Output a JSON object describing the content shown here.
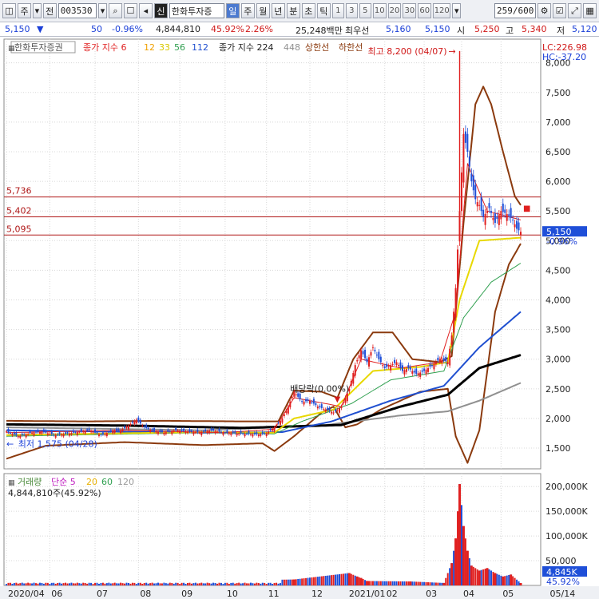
{
  "toolbar": {
    "market": "주",
    "scope": "전",
    "code": "003530",
    "badge": "신",
    "name": "한화투자증",
    "periods": [
      "일",
      "주",
      "월",
      "년",
      "분",
      "초",
      "틱"
    ],
    "selected_period": "일",
    "intervals": [
      "1",
      "3",
      "5",
      "10",
      "20",
      "30",
      "60",
      "120"
    ],
    "count": "259/600"
  },
  "quote": {
    "price": "5,150",
    "change": "50",
    "change_pct": "-0.96%",
    "volume": "4,844,810",
    "turnover": "45.92%",
    "ratio": "2.26%",
    "amount": "25,248백만",
    "best_label": "최우선",
    "bid": "5,160",
    "ask": "5,150",
    "open_label": "시",
    "open": "5,250",
    "high_label": "고",
    "high": "5,340",
    "low_label": "저",
    "low": "5,120"
  },
  "price_legend": {
    "broker": "한화투자증권",
    "ma_label": "종가 지수 6",
    "ma2": "12",
    "ma3": "33",
    "ma4": "56",
    "ma5": "112",
    "env_label": "종가 지수 224",
    "env2": "448",
    "upper": "상한선",
    "lower": "하한선"
  },
  "annotations": {
    "lc": "LC:226.98",
    "hc": "HC:-37.20",
    "max_label": "최고 8,200 (04/07)",
    "min_label": "최저 1,575 (04/28)",
    "dividend": "배당락(0.00%)",
    "cur_price": "5,150",
    "cur_pct": "-0.96%",
    "level1": "5,736",
    "level2": "5,402",
    "level3": "5,095"
  },
  "volume_legend": {
    "label": "거래량",
    "ma_label": "단순 5",
    "ma2": "20",
    "ma3": "60",
    "ma4": "120",
    "value": "4,844,810주(45.92%)",
    "cur_badge": "4,845K",
    "cur_pct": "45.92%"
  },
  "colors": {
    "up": "#e02020",
    "down": "#1f4fd8",
    "ma6": "#e02020",
    "ma12": "#f0a000",
    "ma33": "#e8d800",
    "ma56": "#30a050",
    "ma112": "#2050d0",
    "ma224": "#000000",
    "ma448": "#909090",
    "envelope": "#8b3a0e"
  },
  "chart_data": {
    "type": "line",
    "price_axis": {
      "ticks": [
        1500,
        2000,
        2500,
        3000,
        3500,
        4000,
        4500,
        5000,
        5500,
        6000,
        6500,
        7000,
        7500,
        8000
      ],
      "tick_labels": [
        "1,500",
        "2,000",
        "2,500",
        "3,000",
        "3,500",
        "4,000",
        "4,500",
        "5,000",
        "5,500",
        "6,000",
        "6,500",
        "7,000",
        "7,500",
        "8,000"
      ],
      "ylim": [
        1150,
        8400
      ]
    },
    "volume_axis": {
      "ticks": [
        50000,
        100000,
        150000,
        200000
      ],
      "tick_labels": [
        "50,000",
        "100,000K",
        "150,000K",
        "200,000K"
      ],
      "ylim": [
        0,
        210000
      ]
    },
    "x_axis": {
      "labels": [
        "2020/04",
        "06",
        "07",
        "08",
        "09",
        "10",
        "11",
        "12",
        "2021/01",
        "02",
        "03",
        "04",
        "05",
        "05/14"
      ],
      "positions": [
        0,
        22,
        45,
        67,
        88,
        111,
        132,
        154,
        173,
        192,
        212,
        231,
        251,
        275
      ]
    },
    "n_days": 262,
    "close": [
      [
        0,
        1780
      ],
      [
        6,
        1700
      ],
      [
        12,
        1750
      ],
      [
        18,
        1780
      ],
      [
        24,
        1720
      ],
      [
        30,
        1740
      ],
      [
        36,
        1770
      ],
      [
        42,
        1800
      ],
      [
        48,
        1720
      ],
      [
        54,
        1790
      ],
      [
        58,
        1800
      ],
      [
        62,
        1880
      ],
      [
        66,
        1980
      ],
      [
        70,
        1850
      ],
      [
        75,
        1780
      ],
      [
        80,
        1760
      ],
      [
        86,
        1800
      ],
      [
        92,
        1780
      ],
      [
        98,
        1760
      ],
      [
        104,
        1800
      ],
      [
        110,
        1760
      ],
      [
        116,
        1750
      ],
      [
        122,
        1740
      ],
      [
        128,
        1730
      ],
      [
        132,
        1750
      ],
      [
        136,
        1850
      ],
      [
        140,
        2000
      ],
      [
        143,
        2200
      ],
      [
        146,
        2450
      ],
      [
        150,
        2280
      ],
      [
        154,
        2300
      ],
      [
        158,
        2200
      ],
      [
        162,
        2150
      ],
      [
        166,
        2100
      ],
      [
        170,
        2200
      ],
      [
        174,
        2500
      ],
      [
        177,
        2900
      ],
      [
        180,
        3150
      ],
      [
        183,
        2950
      ],
      [
        186,
        3200
      ],
      [
        189,
        3000
      ],
      [
        192,
        2850
      ],
      [
        195,
        2900
      ],
      [
        198,
        2950
      ],
      [
        201,
        2800
      ],
      [
        204,
        2850
      ],
      [
        208,
        2750
      ],
      [
        212,
        2800
      ],
      [
        216,
        2900
      ],
      [
        220,
        3000
      ],
      [
        224,
        2950
      ],
      [
        226,
        3400
      ],
      [
        228,
        4200
      ],
      [
        230,
        5500
      ],
      [
        232,
        6800
      ],
      [
        234,
        6500
      ],
      [
        236,
        6000
      ],
      [
        238,
        5700
      ],
      [
        240,
        5600
      ],
      [
        242,
        5400
      ],
      [
        245,
        5550
      ],
      [
        248,
        5300
      ],
      [
        251,
        5500
      ],
      [
        254,
        5450
      ],
      [
        257,
        5350
      ],
      [
        259,
        5200
      ],
      [
        261,
        5150
      ]
    ],
    "ma6": [
      [
        0,
        1760
      ],
      [
        60,
        1800
      ],
      [
        110,
        1760
      ],
      [
        136,
        1820
      ],
      [
        146,
        2350
      ],
      [
        170,
        2200
      ],
      [
        180,
        3000
      ],
      [
        200,
        2850
      ],
      [
        220,
        2950
      ],
      [
        228,
        3800
      ],
      [
        234,
        6300
      ],
      [
        244,
        5500
      ],
      [
        261,
        5350
      ]
    ],
    "ma33": [
      [
        0,
        1720
      ],
      [
        100,
        1770
      ],
      [
        136,
        1760
      ],
      [
        146,
        2000
      ],
      [
        166,
        2150
      ],
      [
        186,
        2800
      ],
      [
        210,
        2870
      ],
      [
        224,
        2950
      ],
      [
        230,
        4000
      ],
      [
        240,
        5000
      ],
      [
        261,
        5050
      ]
    ],
    "ma56": [
      [
        0,
        1700
      ],
      [
        100,
        1760
      ],
      [
        136,
        1740
      ],
      [
        150,
        1950
      ],
      [
        175,
        2250
      ],
      [
        195,
        2650
      ],
      [
        222,
        2800
      ],
      [
        232,
        3700
      ],
      [
        246,
        4300
      ],
      [
        261,
        4620
      ]
    ],
    "ma112": [
      [
        0,
        1800
      ],
      [
        100,
        1760
      ],
      [
        140,
        1770
      ],
      [
        165,
        1950
      ],
      [
        195,
        2300
      ],
      [
        222,
        2550
      ],
      [
        240,
        3200
      ],
      [
        261,
        3800
      ]
    ],
    "ma224": [
      [
        0,
        1900
      ],
      [
        60,
        1880
      ],
      [
        120,
        1840
      ],
      [
        170,
        1890
      ],
      [
        200,
        2200
      ],
      [
        224,
        2400
      ],
      [
        240,
        2850
      ],
      [
        261,
        3070
      ]
    ],
    "ma448": [
      [
        0,
        1850
      ],
      [
        100,
        1800
      ],
      [
        160,
        1880
      ],
      [
        200,
        2050
      ],
      [
        224,
        2120
      ],
      [
        240,
        2300
      ],
      [
        261,
        2600
      ]
    ],
    "envelope_upper": [
      [
        0,
        1960
      ],
      [
        40,
        1950
      ],
      [
        80,
        1960
      ],
      [
        120,
        1950
      ],
      [
        138,
        1950
      ],
      [
        146,
        2470
      ],
      [
        160,
        2450
      ],
      [
        168,
        2350
      ],
      [
        176,
        3000
      ],
      [
        186,
        3450
      ],
      [
        196,
        3450
      ],
      [
        206,
        3000
      ],
      [
        220,
        2950
      ],
      [
        226,
        3050
      ],
      [
        232,
        5300
      ],
      [
        238,
        7300
      ],
      [
        242,
        7600
      ],
      [
        246,
        7300
      ],
      [
        252,
        6500
      ],
      [
        258,
        5750
      ],
      [
        261,
        5600
      ]
    ],
    "envelope_lower": [
      [
        0,
        1320
      ],
      [
        20,
        1540
      ],
      [
        60,
        1600
      ],
      [
        100,
        1550
      ],
      [
        130,
        1580
      ],
      [
        136,
        1450
      ],
      [
        146,
        1700
      ],
      [
        160,
        2100
      ],
      [
        166,
        2200
      ],
      [
        172,
        1850
      ],
      [
        178,
        1900
      ],
      [
        190,
        2150
      ],
      [
        210,
        2450
      ],
      [
        224,
        2500
      ],
      [
        228,
        1700
      ],
      [
        234,
        1250
      ],
      [
        240,
        1800
      ],
      [
        248,
        3800
      ],
      [
        255,
        4600
      ],
      [
        261,
        4950
      ]
    ],
    "volume_spikes": [
      [
        146,
        12000
      ],
      [
        174,
        25000
      ],
      [
        178,
        18000
      ],
      [
        180,
        15000
      ],
      [
        183,
        9000
      ],
      [
        205,
        8000
      ],
      [
        222,
        5000
      ],
      [
        226,
        45000
      ],
      [
        228,
        95000
      ],
      [
        230,
        205000
      ],
      [
        232,
        120000
      ],
      [
        234,
        70000
      ],
      [
        236,
        40000
      ],
      [
        240,
        30000
      ],
      [
        244,
        35000
      ],
      [
        248,
        25000
      ],
      [
        252,
        18000
      ],
      [
        256,
        22000
      ],
      [
        261,
        4845
      ]
    ]
  }
}
